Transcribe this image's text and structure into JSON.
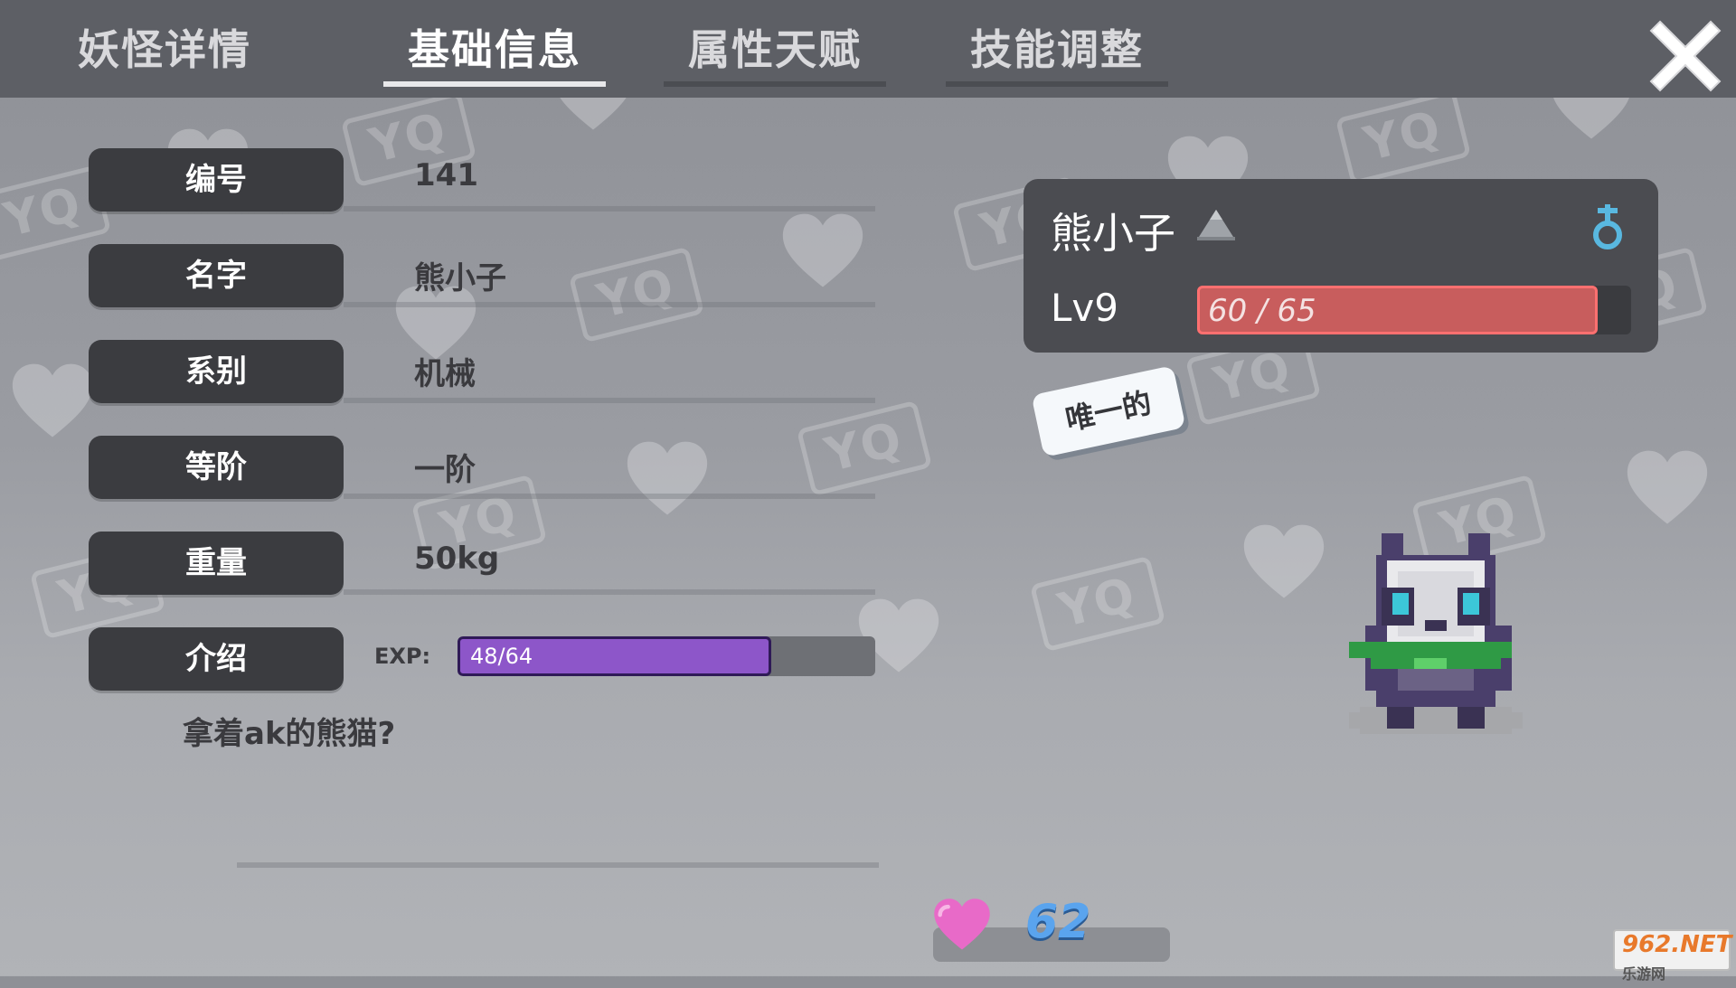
{
  "tabs": {
    "title": "妖怪详情",
    "basic": "基础信息",
    "attributes": "属性天赋",
    "skills": "技能调整"
  },
  "info": {
    "number": {
      "label": "编号",
      "value": "141"
    },
    "name": {
      "label": "名字",
      "value": "熊小子"
    },
    "type": {
      "label": "系别",
      "value": "机械"
    },
    "tier": {
      "label": "等阶",
      "value": "一阶"
    },
    "weight": {
      "label": "重量",
      "value": "50kg"
    },
    "intro": {
      "label": "介绍",
      "text": "拿着ak的熊猫?"
    },
    "exp": {
      "label": "EXP:",
      "text": "48/64",
      "current": 48,
      "max": 64
    }
  },
  "card": {
    "name": "熊小子",
    "level": "Lv9",
    "hp_text": "60 / 65",
    "hp_current": 60,
    "hp_max": 65,
    "rank_icon": "mountain-rank-icon",
    "gender_icon": "gender-icon",
    "gender_color": "#59b8e0"
  },
  "badge": "唯一的",
  "affection": {
    "value": "62",
    "icon": "heart-icon",
    "color": "#e86ac8"
  },
  "watermark_text": "YQ",
  "corner_logo": {
    "main": "962.NET",
    "sub": "乐游网"
  },
  "colors": {
    "topbar": "#5d5f65",
    "label_bg": "#3b3c40",
    "exp_fill": "#8d56c9",
    "hp_fill": "#c85d5d",
    "love_value": "#5aa4ee"
  }
}
